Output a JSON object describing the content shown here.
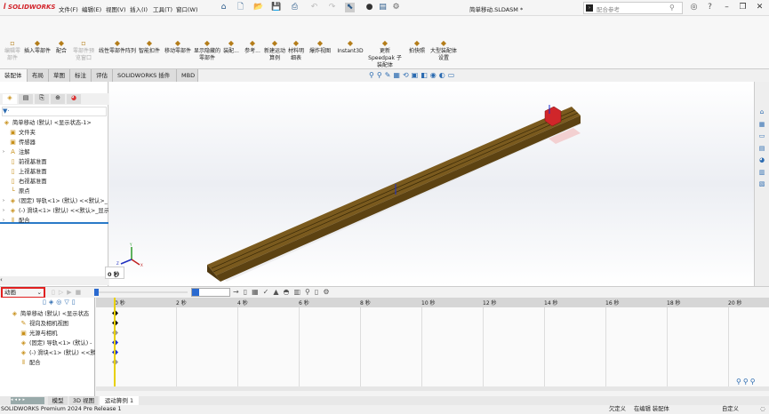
{
  "titlebar": {
    "logo": "SOLIDWORKS",
    "menus": [
      "文件(F)",
      "编辑(E)",
      "视图(V)",
      "插入(I)",
      "工具(T)",
      "窗口(W)"
    ],
    "document_title": "简单移动.SLDASM *",
    "search_placeholder": "配合参考"
  },
  "ribbon": {
    "buttons": [
      {
        "label": "编辑零部件",
        "disabled": true,
        "icon": "edit-component-icon"
      },
      {
        "label": "插入零部件",
        "disabled": false,
        "icon": "insert-component-icon"
      },
      {
        "label": "配合",
        "disabled": false,
        "icon": "mate-icon"
      },
      {
        "label": "零部件预览窗口",
        "disabled": true,
        "icon": "preview-window-icon"
      },
      {
        "label": "线性零部件阵列",
        "disabled": false,
        "icon": "linear-pattern-icon"
      },
      {
        "label": "智能扣件",
        "disabled": false,
        "icon": "smart-fastener-icon"
      },
      {
        "label": "移动零部件",
        "disabled": false,
        "icon": "move-component-icon"
      },
      {
        "label": "显示隐藏的零部件",
        "disabled": false,
        "icon": "show-hidden-icon"
      },
      {
        "label": "装配...",
        "disabled": false,
        "icon": "assembly-feature-icon"
      },
      {
        "label": "参考...",
        "disabled": false,
        "icon": "reference-geometry-icon"
      },
      {
        "label": "新建运动算例",
        "disabled": false,
        "icon": "new-motion-study-icon"
      },
      {
        "label": "材料明细表",
        "disabled": false,
        "icon": "bom-icon"
      },
      {
        "label": "爆炸视图",
        "disabled": false,
        "icon": "exploded-view-icon"
      },
      {
        "label": "Instant3D",
        "disabled": false,
        "icon": "instant3d-icon"
      },
      {
        "label": "更新 Speedpak 子装配体",
        "disabled": false,
        "icon": "speedpak-icon"
      },
      {
        "label": "拍快照",
        "disabled": false,
        "icon": "snapshot-icon"
      },
      {
        "label": "大型装配体设置",
        "disabled": false,
        "icon": "large-assembly-icon"
      }
    ]
  },
  "tabs": [
    "装配体",
    "布局",
    "草图",
    "标注",
    "评估",
    "SOLIDWORKS 插件",
    "MBD"
  ],
  "active_tab": "装配体",
  "feature_tree": [
    {
      "label": "简单移动 (默认) <显示状态-1>",
      "icon": "assembly-icon",
      "indent": 0,
      "expander": false
    },
    {
      "label": "文件夹",
      "icon": "folder-icon",
      "indent": 1,
      "expander": false
    },
    {
      "label": "传感器",
      "icon": "sensor-icon",
      "indent": 1,
      "expander": false
    },
    {
      "label": "注解",
      "icon": "annotation-icon",
      "indent": 1,
      "expander": true
    },
    {
      "label": "前视基准面",
      "icon": "plane-icon",
      "indent": 1,
      "expander": false
    },
    {
      "label": "上视基准面",
      "icon": "plane-icon",
      "indent": 1,
      "expander": false
    },
    {
      "label": "右视基准面",
      "icon": "plane-icon",
      "indent": 1,
      "expander": false
    },
    {
      "label": "原点",
      "icon": "origin-icon",
      "indent": 1,
      "expander": false
    },
    {
      "label": "(固定) 导轨<1> (默认) <<默认>_",
      "icon": "part-icon",
      "indent": 1,
      "expander": true
    },
    {
      "label": "(-) 滑块<1> (默认) <<默认>_显示",
      "icon": "part-icon",
      "indent": 1,
      "expander": true
    },
    {
      "label": "配合",
      "icon": "mates-icon",
      "indent": 1,
      "expander": true
    }
  ],
  "viewport": {
    "time_label": "0 秒",
    "triad": [
      "X",
      "Y",
      "Z"
    ],
    "rail_color": "#7a5a1e",
    "slider_color": "#d0262a"
  },
  "motion": {
    "study_type": "动画",
    "time_field": "",
    "tree": [
      {
        "label": "简单移动 (默认) <显示状态",
        "icon": "assembly-icon"
      },
      {
        "label": "视向及相机视图",
        "icon": "camera-view-icon"
      },
      {
        "label": "光源与相机",
        "icon": "lights-icon"
      },
      {
        "label": "(固定) 导轨<1> (默认) -",
        "icon": "part-icon"
      },
      {
        "label": "(-) 滑块<1> (默认) <<默",
        "icon": "part-icon"
      },
      {
        "label": "配合",
        "icon": "mates-icon"
      }
    ],
    "key_colors": [
      "#111111",
      "#111111",
      "#999999",
      "#1a2fd0",
      "#1a2fd0",
      "#999999"
    ],
    "ticks": [
      "0 秒",
      "2 秒",
      "4 秒",
      "6 秒",
      "8 秒",
      "10 秒",
      "12 秒",
      "14 秒",
      "16 秒",
      "18 秒",
      "20 秒"
    ]
  },
  "bottom_tabs": [
    "模型",
    "3D 视图",
    "运动算例 1"
  ],
  "status": {
    "product": "SOLIDWORKS Premium 2024 Pre Release 1",
    "defined": "欠定义",
    "editing": "在编辑 装配体",
    "units": "自定义"
  }
}
